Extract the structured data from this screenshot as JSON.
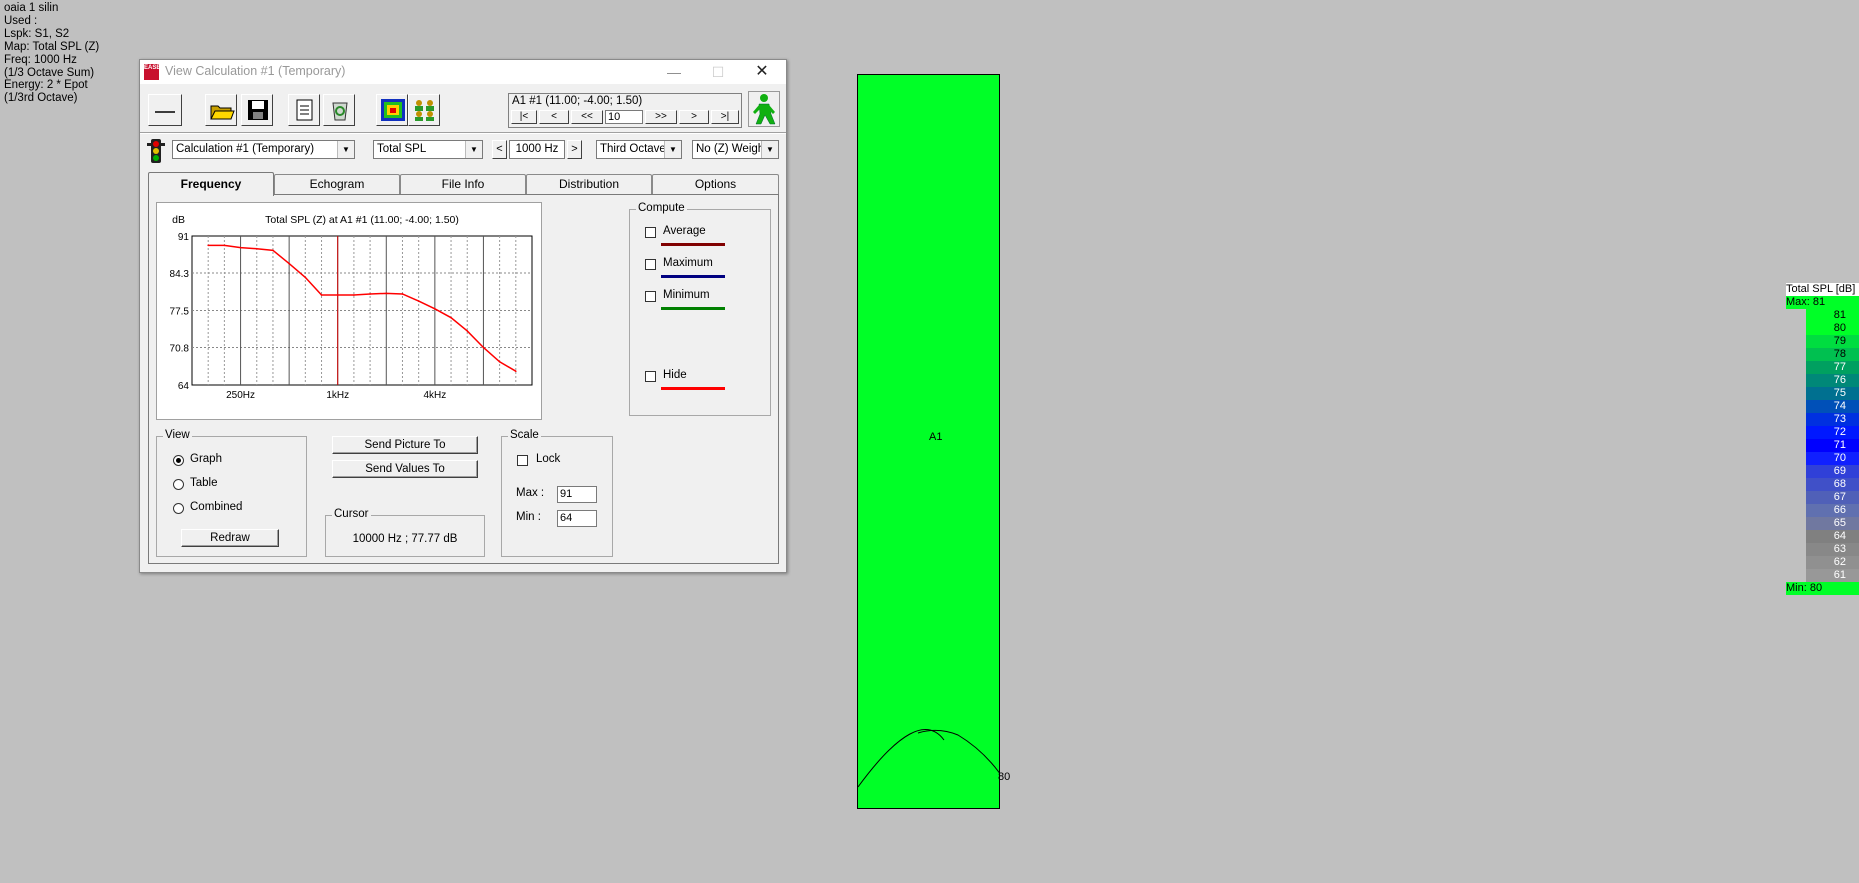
{
  "info_lines": [
    "oaia 1 silin",
    "Used :",
    "Lspk: S1, S2",
    "Map: Total SPL (Z)",
    "Freq: 1000 Hz",
    "(1/3 Octave Sum)",
    "Energy: 2 * Epot",
    "(1/3rd Octave)"
  ],
  "window": {
    "title": "View Calculation #1 (Temporary)",
    "app_icon_text": "EASE"
  },
  "toolbar": {
    "position_label": "A1 #1  (11.00; -4.00; 1.50)",
    "nav_first": "|<",
    "nav_prev": "<",
    "nav_prev_step": "<<",
    "nav_step_value": "10",
    "nav_next_step": ">>",
    "nav_next": ">",
    "nav_last": ">|"
  },
  "selectors": {
    "calculation": "Calculation #1 (Temporary)",
    "quantity": "Total SPL",
    "freq_prev": "<",
    "frequency": "1000 Hz",
    "freq_next": ">",
    "band": "Third Octave",
    "weighting": "No (Z) Weigh"
  },
  "tabs": [
    {
      "label": "Frequency",
      "active": true
    },
    {
      "label": "Echogram",
      "active": false
    },
    {
      "label": "File Info",
      "active": false
    },
    {
      "label": "Distribution",
      "active": false
    },
    {
      "label": "Options",
      "active": false
    }
  ],
  "chart_data": {
    "type": "line",
    "title": "Total SPL (Z) at A1 #1  (11.00; -4.00; 1.50)",
    "ylabel": "dB",
    "ylim": [
      64,
      91
    ],
    "yticks": [
      "91",
      "84.3",
      "77.5",
      "70.8",
      "64"
    ],
    "x_tick_labels": [
      {
        "label": "250Hz",
        "band_index": 3
      },
      {
        "label": "1kHz",
        "band_index": 9
      },
      {
        "label": "4kHz",
        "band_index": 15
      }
    ],
    "x_band_count": 21,
    "cursor_band_index": 9,
    "series": [
      {
        "color": "#ff0000",
        "bands": [
          1,
          2,
          3,
          4,
          5,
          6,
          7,
          8,
          9,
          10,
          11,
          12,
          13,
          14,
          15,
          16,
          17,
          18,
          19,
          20
        ],
        "values": [
          89.3,
          89.3,
          88.9,
          88.7,
          88.4,
          86.0,
          83.5,
          80.3,
          80.3,
          80.3,
          80.5,
          80.6,
          80.5,
          79.2,
          77.8,
          76.2,
          73.8,
          70.8,
          68.2,
          66.5
        ]
      }
    ]
  },
  "compute": {
    "title": "Compute",
    "items": [
      {
        "label": "Average",
        "color": "#800000"
      },
      {
        "label": "Maximum",
        "color": "#000080"
      },
      {
        "label": "Minimum",
        "color": "#008000"
      },
      {
        "label": "Hide",
        "color": "#ff0000"
      }
    ]
  },
  "view": {
    "title": "View",
    "options": [
      "Graph",
      "Table",
      "Combined"
    ],
    "selected": "Graph",
    "redraw_label": "Redraw"
  },
  "send": {
    "picture_label": "Send Picture To",
    "values_label": "Send Values To"
  },
  "cursor": {
    "title": "Cursor",
    "value": "10000 Hz ; 77.77 dB"
  },
  "scale": {
    "title": "Scale",
    "lock_label": "Lock",
    "max_label": "Max :",
    "max_value": "91",
    "min_label": "Min :",
    "min_value": "64"
  },
  "map": {
    "area_label": "A1",
    "contour_label": "80",
    "fill_color": "#00ff27"
  },
  "legend": {
    "title": "Total SPL [dB]",
    "max_label": "Max:  81",
    "min_label": "Min:  80",
    "rows": [
      {
        "label": "81",
        "color": "#00ff27"
      },
      {
        "label": "80",
        "color": "#00ff27"
      },
      {
        "label": "79",
        "color": "#00dd40"
      },
      {
        "label": "78",
        "color": "#00c050"
      },
      {
        "label": "77",
        "color": "#00a060"
      },
      {
        "label": "76",
        "color": "#008878"
      },
      {
        "label": "75",
        "color": "#007090"
      },
      {
        "label": "74",
        "color": "#0050b8"
      },
      {
        "label": "73",
        "color": "#0030e0"
      },
      {
        "label": "72",
        "color": "#0018ff"
      },
      {
        "label": "71",
        "color": "#0000ff"
      },
      {
        "label": "70",
        "color": "#1020ff"
      },
      {
        "label": "69",
        "color": "#3040d8"
      },
      {
        "label": "68",
        "color": "#4050c8"
      },
      {
        "label": "67",
        "color": "#5060b8"
      },
      {
        "label": "66",
        "color": "#6070b0"
      },
      {
        "label": "65",
        "color": "#7078a0"
      },
      {
        "label": "64",
        "color": "#808080"
      },
      {
        "label": "63",
        "color": "#888888"
      },
      {
        "label": "62",
        "color": "#909090"
      },
      {
        "label": "61",
        "color": "#989898"
      }
    ]
  }
}
